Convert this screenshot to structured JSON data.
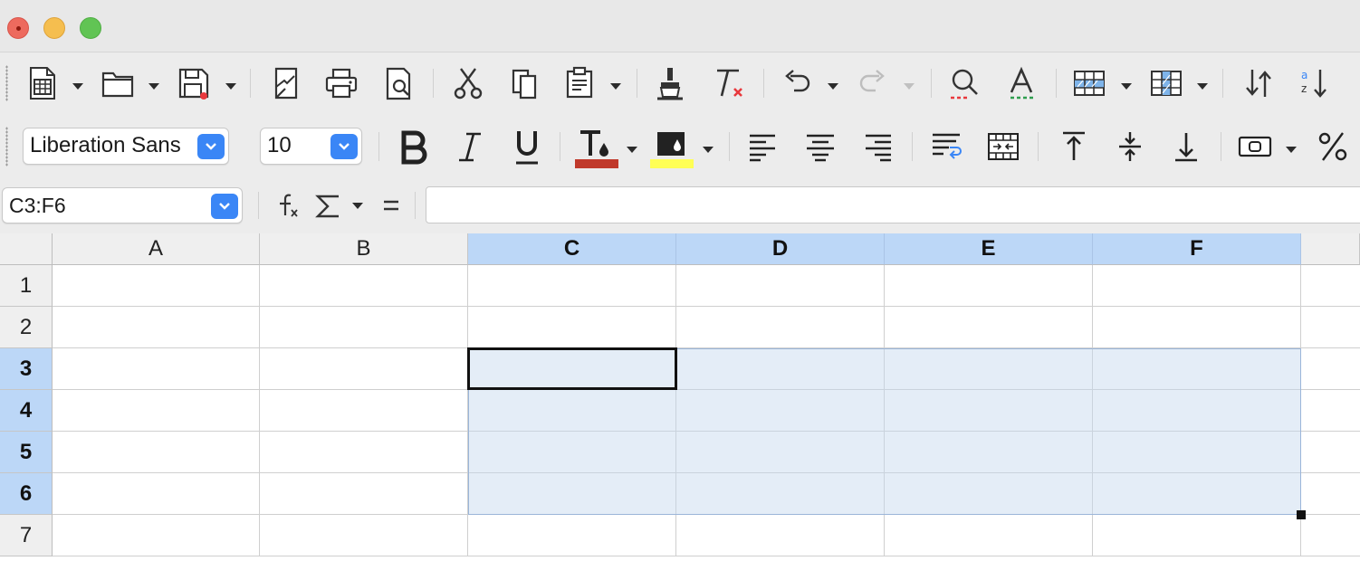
{
  "window": {
    "controls": [
      "close",
      "minimize",
      "zoom"
    ]
  },
  "standard_toolbar": {
    "buttons": [
      {
        "name": "new-document",
        "icon": "spreadsheet-icon",
        "dropdown": true
      },
      {
        "name": "open",
        "icon": "folder-icon",
        "dropdown": true
      },
      {
        "name": "save",
        "icon": "floppy-disk-icon",
        "dropdown": true
      },
      {
        "name": "export-pdf",
        "icon": "export-pdf-icon"
      },
      {
        "name": "print",
        "icon": "printer-icon"
      },
      {
        "name": "print-preview",
        "icon": "print-preview-icon"
      },
      {
        "name": "cut",
        "icon": "scissors-icon"
      },
      {
        "name": "copy",
        "icon": "copy-icon"
      },
      {
        "name": "paste",
        "icon": "clipboard-icon",
        "dropdown": true
      },
      {
        "name": "clone-formatting",
        "icon": "paintbrush-icon"
      },
      {
        "name": "clear-formatting",
        "icon": "clear-format-icon"
      },
      {
        "name": "undo",
        "icon": "undo-icon",
        "dropdown": true
      },
      {
        "name": "redo",
        "icon": "redo-icon",
        "dropdown": true,
        "disabled": true
      },
      {
        "name": "find-replace",
        "icon": "magnifier-icon"
      },
      {
        "name": "spelling",
        "icon": "spellcheck-icon"
      },
      {
        "name": "row",
        "icon": "insert-rows-icon",
        "dropdown": true
      },
      {
        "name": "column",
        "icon": "insert-columns-icon",
        "dropdown": true
      },
      {
        "name": "sort-ascending",
        "icon": "sort-icon"
      },
      {
        "name": "sort-az",
        "icon": "sort-az-icon"
      }
    ]
  },
  "formatting_toolbar": {
    "font_name": "Liberation Sans",
    "font_size": "10",
    "font_color": "#c0392b",
    "highlight_color": "#ffff55",
    "buttons": [
      "bold",
      "italic",
      "underline",
      "font-color",
      "highlighting",
      "align-left",
      "align-center",
      "align-right",
      "wrap-text",
      "merge-center",
      "align-top",
      "center-vertically",
      "align-bottom",
      "currency",
      "percent"
    ]
  },
  "formula_bar": {
    "name_box": "C3:F6",
    "formula": ""
  },
  "sheet": {
    "columns": [
      "A",
      "B",
      "C",
      "D",
      "E",
      "F"
    ],
    "rows": [
      "1",
      "2",
      "3",
      "4",
      "5",
      "6",
      "7"
    ],
    "selected_columns": [
      "C",
      "D",
      "E",
      "F"
    ],
    "selected_rows": [
      "3",
      "4",
      "5",
      "6"
    ],
    "active_cell": "C3",
    "selection": "C3:F6",
    "selection_color": "#bcd7f7"
  }
}
